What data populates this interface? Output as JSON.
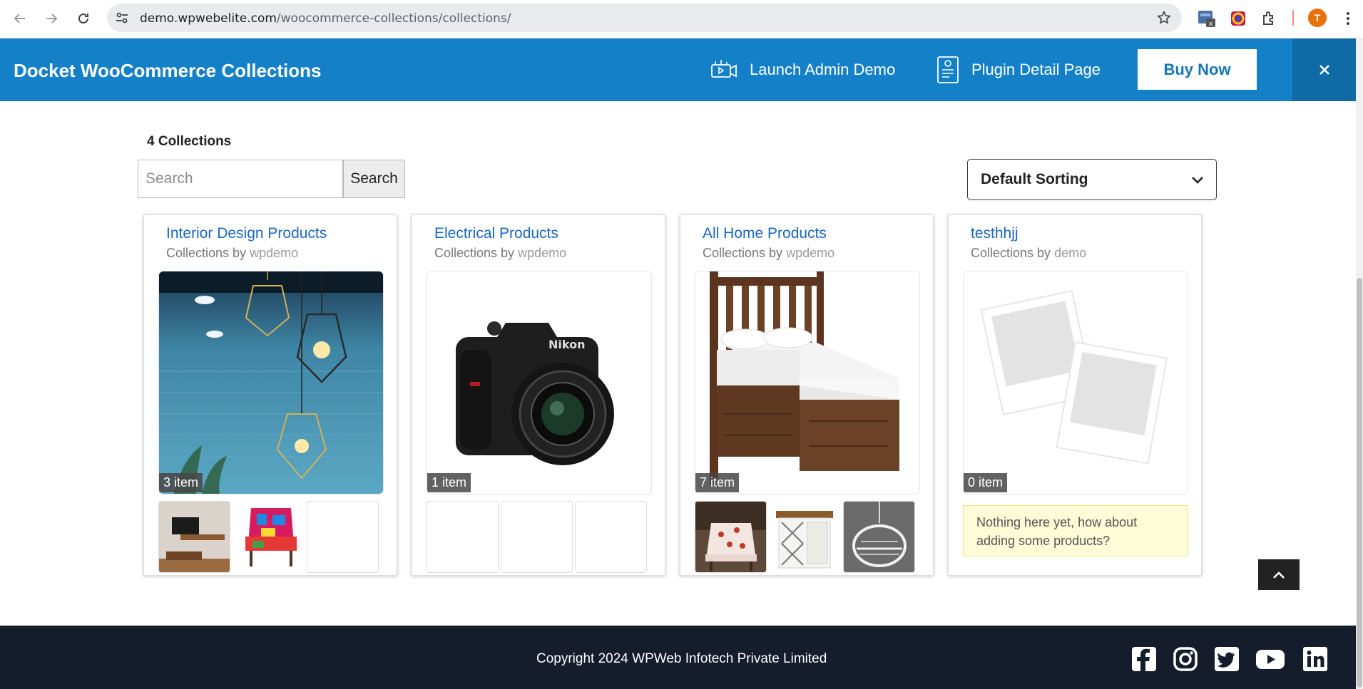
{
  "browser": {
    "url_host": "demo.wpwebelite.com",
    "url_path": "/woocommerce-collections/collections/",
    "profile_initial": "T",
    "extension_badge": "x"
  },
  "demobar": {
    "title": "Docket WooCommerce Collections",
    "launch_label": "Launch Admin Demo",
    "plugin_label": "Plugin Detail Page",
    "buy_label": "Buy Now"
  },
  "collections": {
    "count_label": "4 Collections",
    "search_placeholder": "Search",
    "search_button": "Search",
    "sort_label": "Default Sorting",
    "by_label": "Collections by",
    "cards": [
      {
        "title": "Interior Design Products",
        "author": "wpdemo",
        "item_count": "3 item"
      },
      {
        "title": "Electrical Products",
        "author": "wpdemo",
        "item_count": "1 item"
      },
      {
        "title": "All Home Products",
        "author": "wpdemo",
        "item_count": "7 item"
      },
      {
        "title": "testhhjj",
        "author": "demo",
        "item_count": "0 item",
        "empty_notice": "Nothing here yet, how about adding some products?"
      }
    ]
  },
  "footer": {
    "copyright": "Copyright 2024 WPWeb Infotech Private Limited",
    "social": [
      "facebook-icon",
      "instagram-icon",
      "twitter-icon",
      "youtube-icon",
      "linkedin-icon"
    ]
  },
  "colors": {
    "brand_blue": "#1380c8",
    "link_blue": "#1967c0",
    "footer_bg": "#151c2c"
  }
}
